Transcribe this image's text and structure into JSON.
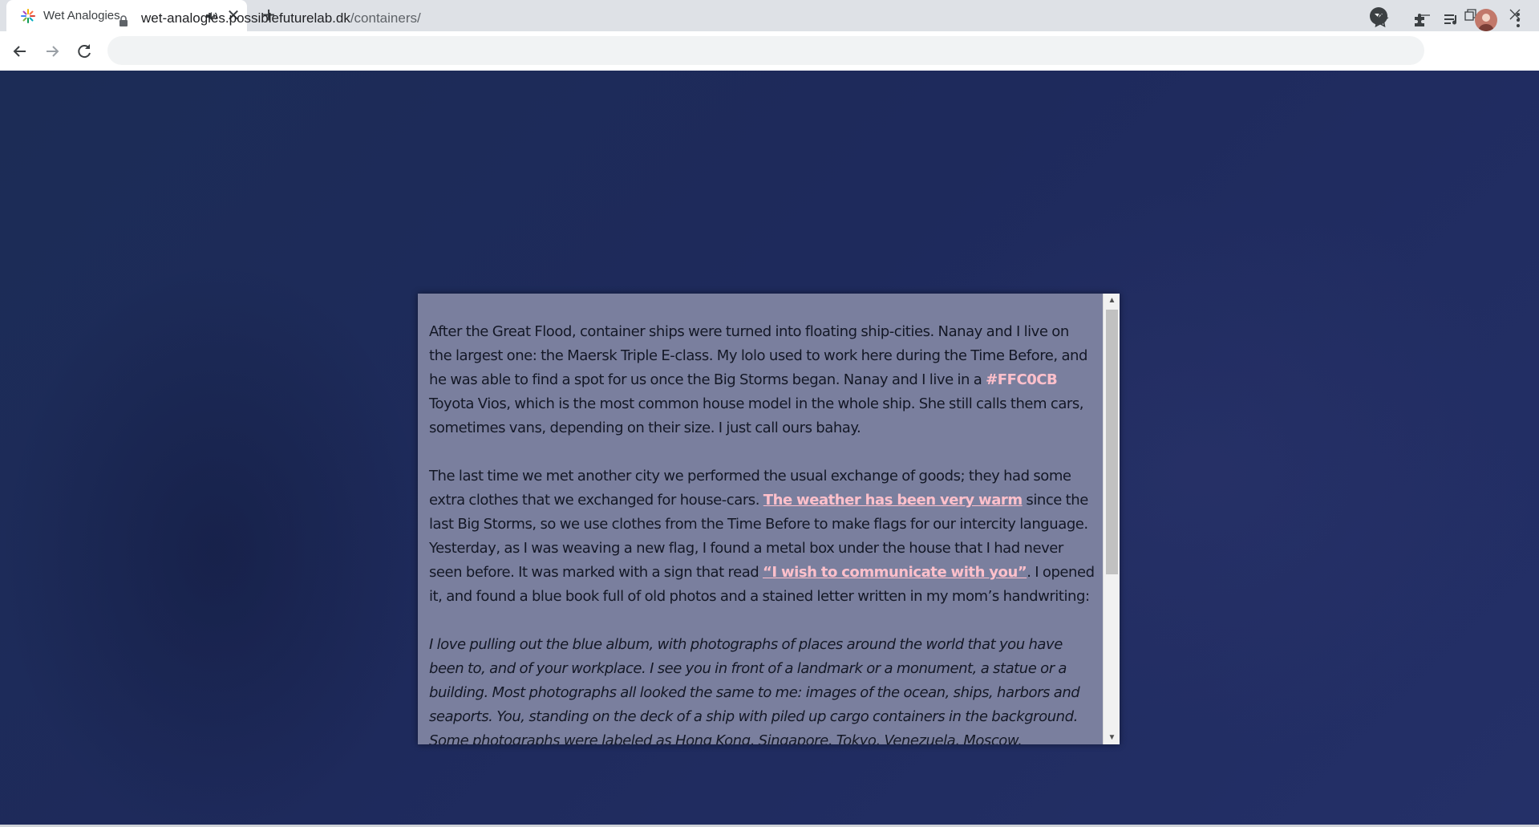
{
  "browser": {
    "tab": {
      "title": "Wet Analogies",
      "audio_icon": "speaker-icon",
      "close_glyph": "✕"
    },
    "new_tab_glyph": "+",
    "url": {
      "domain": "wet-analogies.possiblefuturelab.dk",
      "path": "/containers/"
    }
  },
  "story": {
    "p1": {
      "before": "After the Great Flood, container ships were turned into floating ship-cities. Nanay and I live on the largest one: the Maersk Triple E-class. My lolo used to work here during the Time Before, and he was able to find a spot for us once the Big Storms began. Nanay and I live in a ",
      "highlight": "#FFC0CB",
      "after": " Toyota Vios, which is the most common house model in the whole ship. She still calls them cars, sometimes vans, depending on their size. I just call ours bahay."
    },
    "p2": {
      "before": "The last time we met another city we performed the usual exchange of goods; they had some extra clothes that we exchanged for house-cars. ",
      "link1": "The weather has been very warm",
      "middle": " since the last Big Storms, so we use clothes from the Time Before to make flags for our intercity language. Yesterday, as I was weaving a new flag, I found a metal box under the house that I had never seen before. It was marked with a sign that read ",
      "link2": "“I wish to communicate with you”",
      "after": ". I opened it, and found a blue book full of old photos and a stained letter written in my mom’s handwriting:"
    },
    "p3": "I love pulling out the blue album, with photographs of places around the world that you have been to, and of your workplace. I see you in front of a landmark or a monument, a statue or a building. Most photographs all looked the same to me: images of the ocean, ships, harbors and seaports. You, standing on the deck of a ship with piled up cargo containers in the background. Some photographs were labeled as Hong Kong, Singapore, Tokyo, Venezuela, Moscow, Copenhagen or"
  },
  "colors": {
    "highlight": "#ffc0cb",
    "panel": "#7a7f9e",
    "background": "#1e2a5c"
  }
}
